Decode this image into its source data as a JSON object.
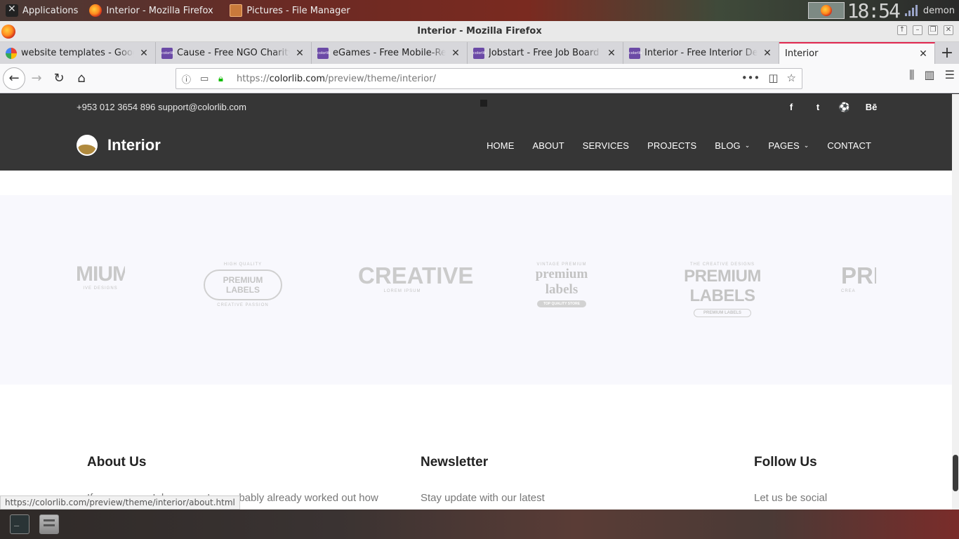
{
  "os_panel": {
    "apps_label": "Applications",
    "firefox_task": "Interior - Mozilla Firefox",
    "files_task": "Pictures - File Manager",
    "clock": "18:54",
    "user": "demon"
  },
  "window": {
    "title": "Interior - Mozilla Firefox"
  },
  "tabs": [
    {
      "label": "website templates - Google S",
      "favicon": "google-icon",
      "active": false
    },
    {
      "label": "Cause - Free NGO Charity We",
      "favicon": "colorlib-icon",
      "active": false
    },
    {
      "label": "eGames - Free Mobile-Ready",
      "favicon": "colorlib-icon",
      "active": false
    },
    {
      "label": "Jobstart - Free Job Board Web",
      "favicon": "colorlib-icon",
      "active": false
    },
    {
      "label": "Interior - Free Interior Design",
      "favicon": "colorlib-icon",
      "active": false
    },
    {
      "label": "Interior",
      "favicon": "none",
      "active": true
    }
  ],
  "urlbar": {
    "prefix": "https://",
    "domain": "colorlib.com",
    "path": "/preview/theme/interior/"
  },
  "site": {
    "topbar": {
      "phone": "+953 012 3654 896",
      "email": "support@colorlib.com",
      "social": [
        "f",
        "t",
        "⚽",
        "Bē"
      ]
    },
    "brand": "Interior",
    "nav": [
      "HOME",
      "ABOUT",
      "SERVICES",
      "PROJECTS",
      "BLOG",
      "PAGES",
      "CONTACT"
    ],
    "logos": {
      "logo1": {
        "big": "MIUM",
        "small": "IVE DESIGNS"
      },
      "logo2": {
        "top": "HIGH QUALITY",
        "main": "PREMIUM LABELS",
        "bottom": "CREATIVE PASSION"
      },
      "logo3": {
        "main": "CREATIVE",
        "bottom": "LOREM IPSUM"
      },
      "logo4": {
        "top": "VINTAGE PREMIUM",
        "main": "premium labels",
        "bottom": "TOP QUALITY STORE"
      },
      "logo5": {
        "top": "THE CREATIVE DESIGNS",
        "main": "PREMIUM LABELS",
        "bottom": "PREMIUM LABELS"
      },
      "logo6": {
        "big": "PRE",
        "small": "CREA"
      }
    },
    "footer": {
      "about_title": "About Us",
      "about_text": "If you own an Iphone, you've probably already worked out how",
      "news_title": "Newsletter",
      "news_text": "Stay update with our latest",
      "follow_title": "Follow Us",
      "follow_text": "Let us be social"
    }
  },
  "status_bar": "https://colorlib.com/preview/theme/interior/about.html"
}
